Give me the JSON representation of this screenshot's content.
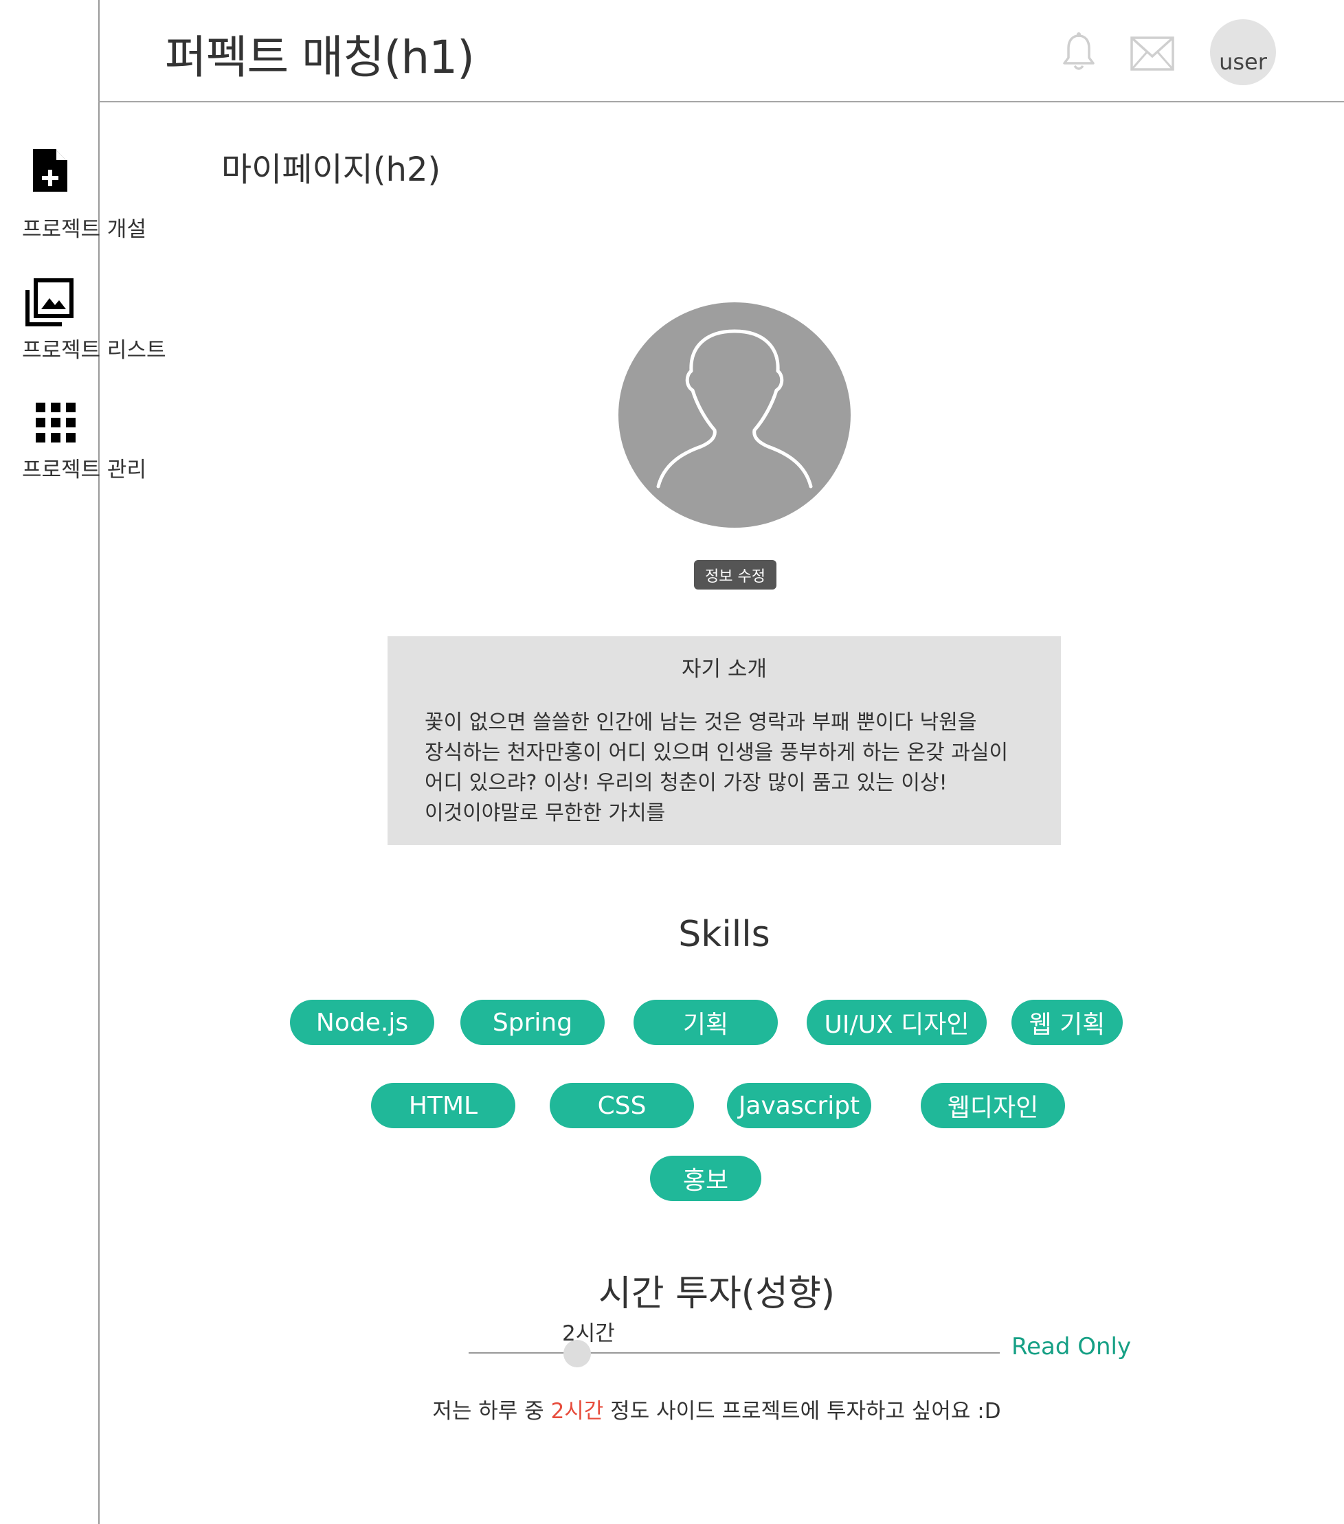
{
  "header": {
    "title": "퍼펙트 매칭(h1)",
    "notifications_icon": "bell-icon",
    "messages_icon": "mail-icon",
    "user_label": "user"
  },
  "sidebar": {
    "items": [
      {
        "label": "프로젝트 개설",
        "icon": "file-plus-icon"
      },
      {
        "label": "프로젝트 리스트",
        "icon": "image-library-icon"
      },
      {
        "label": "프로젝트 관리",
        "icon": "grid-icon"
      }
    ]
  },
  "main": {
    "page_title": "마이페이지(h2)",
    "profile": {
      "edit_button_label": "정보 수정"
    },
    "intro": {
      "title": "자기 소개",
      "text": "꽃이 없으면 쓸쓸한 인간에 남는 것은 영락과 부패 뿐이다 낙원을 장식하는 천자만홍이 어디 있으며 인생을 풍부하게 하는 온갖 과실이 어디 있으랴? 이상! 우리의 청춘이 가장 많이 품고 있는 이상! 이것이야말로 무한한 가치를"
    },
    "skills": {
      "title": "Skills",
      "items": [
        "Node.js",
        "Spring",
        "기획",
        "UI/UX 디자인",
        "웹 기획",
        "HTML",
        "CSS",
        "Javascript",
        "웹디자인",
        "홍보"
      ]
    },
    "time": {
      "title": "시간 투자(성향)",
      "value_label": "2시간",
      "slider_value": 2,
      "mode_label": "Read Only",
      "sentence_prefix": "저는 하루 중 ",
      "sentence_highlight": "2시간",
      "sentence_suffix": " 정도 사이드 프로젝트에 투자하고 싶어요 :D"
    }
  },
  "colors": {
    "accent": "#20b899",
    "read_only": "#16a085",
    "highlight": "#e74c3c",
    "intro_bg": "#e1e1e1",
    "avatar_bg": "#9e9e9e"
  }
}
